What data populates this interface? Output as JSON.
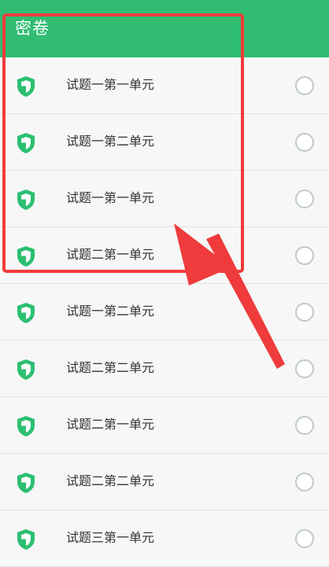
{
  "header": {
    "title": "密卷"
  },
  "list": {
    "items": [
      {
        "label": "试题一第一单元"
      },
      {
        "label": "试题一第二单元"
      },
      {
        "label": "试题一第一单元"
      },
      {
        "label": "试题二第一单元"
      },
      {
        "label": "试题一第二单元"
      },
      {
        "label": "试题二第二单元"
      },
      {
        "label": "试题二第一单元"
      },
      {
        "label": "试题二第二单元"
      },
      {
        "label": "试题三第一单元"
      }
    ]
  },
  "colors": {
    "header_bg": "#30bd72",
    "icon_green": "#2cbf72",
    "annotation_red": "#ef3b3b"
  },
  "icons": {
    "row_icon": "shield-icon",
    "row_control": "radio-button"
  }
}
